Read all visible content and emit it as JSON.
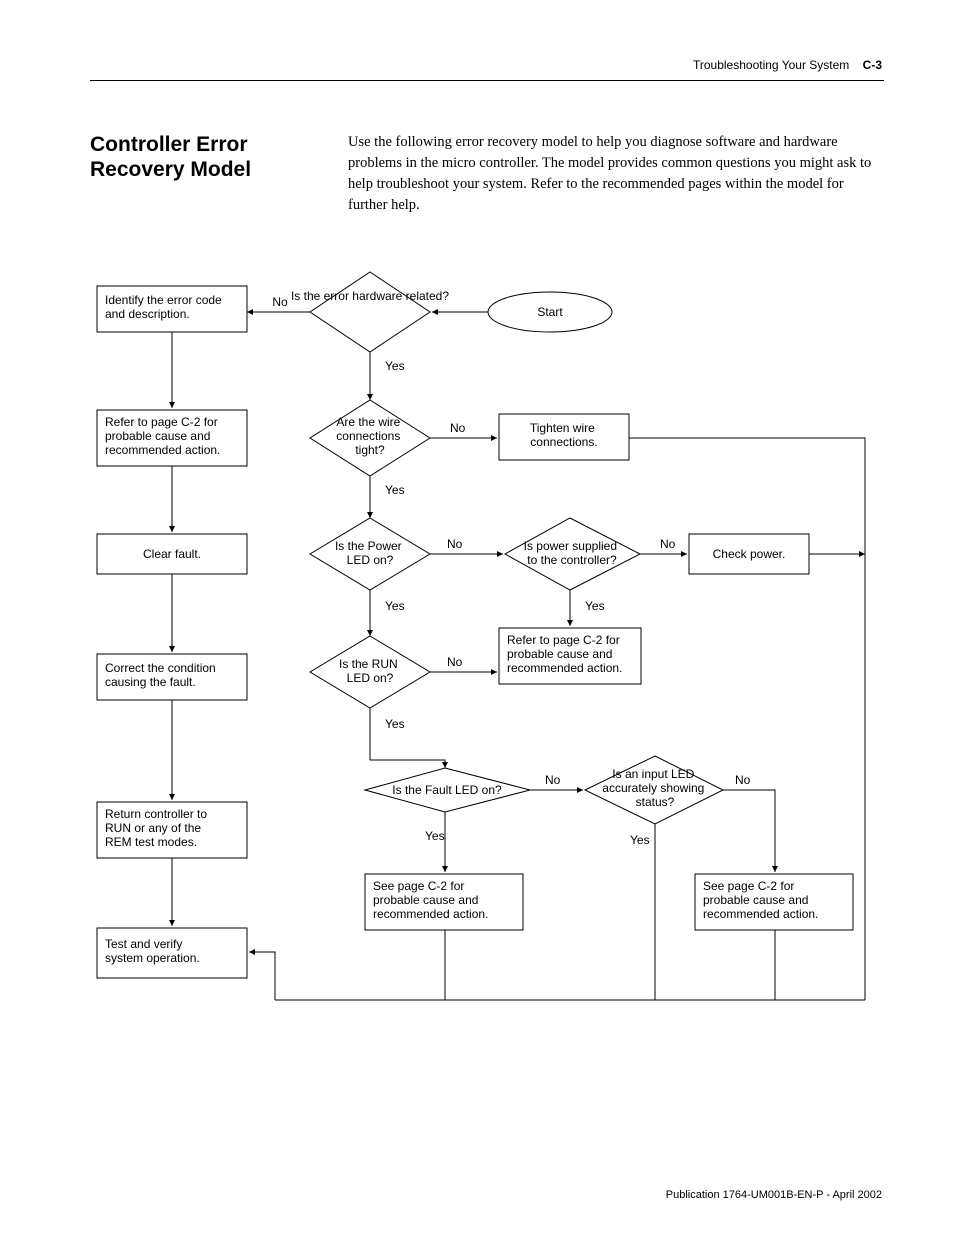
{
  "header": {
    "breadcrumb": "Troubleshooting Your System",
    "pagelabel": "C-3"
  },
  "title": "Controller Error Recovery Model",
  "intro": "Use the following error recovery model to help you diagnose software and hardware problems in the micro controller. The model provides common questions you might ask to help troubleshoot your system. Refer to the recommended pages within the model for further help.",
  "footer": "Publication 1764-UM001B-EN-P - April 2002",
  "flow": {
    "start": "Start",
    "d_hw": "Is the error hardware related?",
    "b_identify_l1": "Identify the error code",
    "b_identify_l2": "and description.",
    "b_refer1_l1": "Refer to page C-2 for",
    "b_refer1_l2": "probable cause and",
    "b_refer1_l3": "recommended action.",
    "d_wire_l1": "Are the wire",
    "d_wire_l2": "connections",
    "d_wire_l3": "tight?",
    "b_tighten_l1": "Tighten wire",
    "b_tighten_l2": "connections.",
    "b_clear": "Clear fault.",
    "d_pled_l1": "Is the Power",
    "d_pled_l2": "LED on?",
    "d_psupply_l1": "Is power supplied",
    "d_psupply_l2": "to the controller?",
    "b_checkpower": "Check power.",
    "b_refer2_l1": "Refer to page C-2 for",
    "b_refer2_l2": "probable cause and",
    "b_refer2_l3": "recommended action.",
    "b_correct_l1": "Correct the condition",
    "b_correct_l2": "causing the fault.",
    "d_runled_l1": "Is the RUN",
    "d_runled_l2": "LED on?",
    "d_faultled": "Is the Fault LED on?",
    "d_inputled_l1": "Is an input LED",
    "d_inputled_l2": "accurately showing",
    "d_inputled_l3": "status?",
    "b_return_l1": "Return controller to",
    "b_return_l2": "RUN or any of the",
    "b_return_l3": "REM test modes.",
    "b_see1_l1": "See page C-2 for",
    "b_see1_l2": "probable cause and",
    "b_see1_l3": "recommended action.",
    "b_see2_l1": "See page C-2 for",
    "b_see2_l2": "probable cause and",
    "b_see2_l3": "recommended action.",
    "b_test_l1": "Test and verify",
    "b_test_l2": "system operation.",
    "yes": "Yes",
    "no": "No"
  }
}
